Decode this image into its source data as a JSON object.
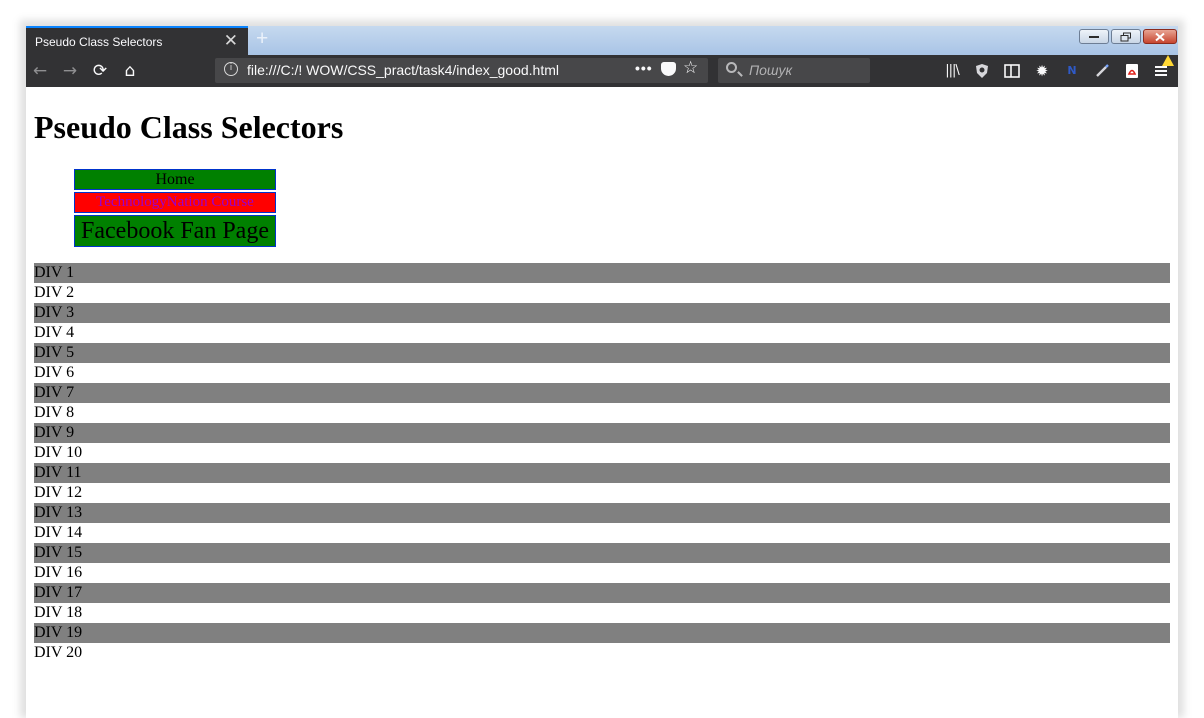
{
  "browser": {
    "tab_title": "Pseudo Class Selectors",
    "tab_close_glyph": "✕",
    "new_tab_glyph": "+",
    "url": "file:///C:/! WOW/CSS_pract/task4/index_good.html",
    "search_placeholder": "Пошук",
    "page_actions_glyph": "•••",
    "bookmark_glyph": "☆",
    "accent_color": "#0a84ff",
    "toolbar_icons": [
      "library-icon",
      "shield-icon",
      "reader-view-icon",
      "gear-icon",
      "extension-icon",
      "pen-icon",
      "pdf-icon",
      "menu-icon"
    ]
  },
  "page": {
    "heading": "Pseudo Class Selectors",
    "menu": [
      {
        "label": "Home",
        "color": "#008000"
      },
      {
        "label": "TechnologyNation Course",
        "color": "#ff0000"
      },
      {
        "label": "Facebook Fan Page",
        "color": "#008000"
      }
    ],
    "divs": [
      "DIV 1",
      "DIV 2",
      "DIV 3",
      "DIV 4",
      "DIV 5",
      "DIV 6",
      "DIV 7",
      "DIV 8",
      "DIV 9",
      "DIV 10",
      "DIV 11",
      "DIV 12",
      "DIV 13",
      "DIV 14",
      "DIV 15",
      "DIV 16",
      "DIV 17",
      "DIV 18",
      "DIV 19",
      "DIV 20"
    ],
    "stripe_color": "#808080"
  }
}
